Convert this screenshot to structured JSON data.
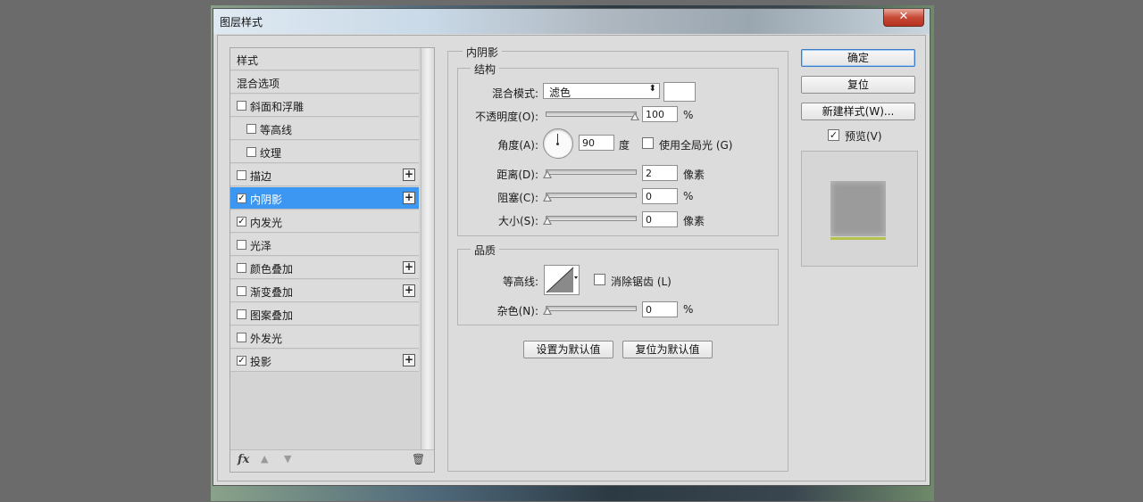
{
  "window": {
    "title": "图层样式",
    "close_label": "✕"
  },
  "style_list": {
    "header": "样式",
    "items": [
      {
        "label": "混合选项",
        "checkbox": false,
        "checked": false,
        "plus": false,
        "indent": 0,
        "selected": false
      },
      {
        "label": "斜面和浮雕",
        "checkbox": true,
        "checked": false,
        "plus": false,
        "indent": 0,
        "selected": false
      },
      {
        "label": "等高线",
        "checkbox": true,
        "checked": false,
        "plus": false,
        "indent": 1,
        "selected": false
      },
      {
        "label": "纹理",
        "checkbox": true,
        "checked": false,
        "plus": false,
        "indent": 1,
        "selected": false
      },
      {
        "label": "描边",
        "checkbox": true,
        "checked": false,
        "plus": true,
        "indent": 0,
        "selected": false
      },
      {
        "label": "内阴影",
        "checkbox": true,
        "checked": true,
        "plus": true,
        "indent": 0,
        "selected": true
      },
      {
        "label": "内发光",
        "checkbox": true,
        "checked": true,
        "plus": false,
        "indent": 0,
        "selected": false
      },
      {
        "label": "光泽",
        "checkbox": true,
        "checked": false,
        "plus": false,
        "indent": 0,
        "selected": false
      },
      {
        "label": "颜色叠加",
        "checkbox": true,
        "checked": false,
        "plus": true,
        "indent": 0,
        "selected": false
      },
      {
        "label": "渐变叠加",
        "checkbox": true,
        "checked": false,
        "plus": true,
        "indent": 0,
        "selected": false
      },
      {
        "label": "图案叠加",
        "checkbox": true,
        "checked": false,
        "plus": false,
        "indent": 0,
        "selected": false
      },
      {
        "label": "外发光",
        "checkbox": true,
        "checked": false,
        "plus": false,
        "indent": 0,
        "selected": false
      },
      {
        "label": "投影",
        "checkbox": true,
        "checked": true,
        "plus": true,
        "indent": 0,
        "selected": false
      }
    ],
    "footer": {
      "fx_label": "fx",
      "up_icon": "▲",
      "down_icon": "▼",
      "trash_icon": "🗑"
    }
  },
  "inner_shadow": {
    "title": "内阴影",
    "structure": {
      "title": "结构",
      "blend_mode_label": "混合模式:",
      "blend_mode_value": "滤色",
      "blend_color": "#ffffff",
      "opacity_label": "不透明度(O):",
      "opacity_value": "100",
      "opacity_unit": "%",
      "opacity_fraction": 1.0,
      "angle_label": "角度(A):",
      "angle_value": "90",
      "angle_unit": "度",
      "global_light_label": "使用全局光 (G)",
      "global_light_checked": false,
      "distance_label": "距离(D):",
      "distance_value": "2",
      "distance_unit": "像素",
      "choke_label": "阻塞(C):",
      "choke_value": "0",
      "choke_unit": "%",
      "size_label": "大小(S):",
      "size_value": "0",
      "size_unit": "像素"
    },
    "quality": {
      "title": "品质",
      "contour_label": "等高线:",
      "antialias_label": "消除锯齿 (L)",
      "antialias_checked": false,
      "noise_label": "杂色(N):",
      "noise_value": "0",
      "noise_unit": "%"
    },
    "set_default_label": "设置为默认值",
    "reset_default_label": "复位为默认值"
  },
  "buttons": {
    "ok": "确定",
    "reset": "复位",
    "new_style": "新建样式(W)...",
    "preview_label": "预览(V)",
    "preview_checked": true
  },
  "preview_colors": {
    "square": "#9b9b9b",
    "bar": "#b5c24c"
  }
}
